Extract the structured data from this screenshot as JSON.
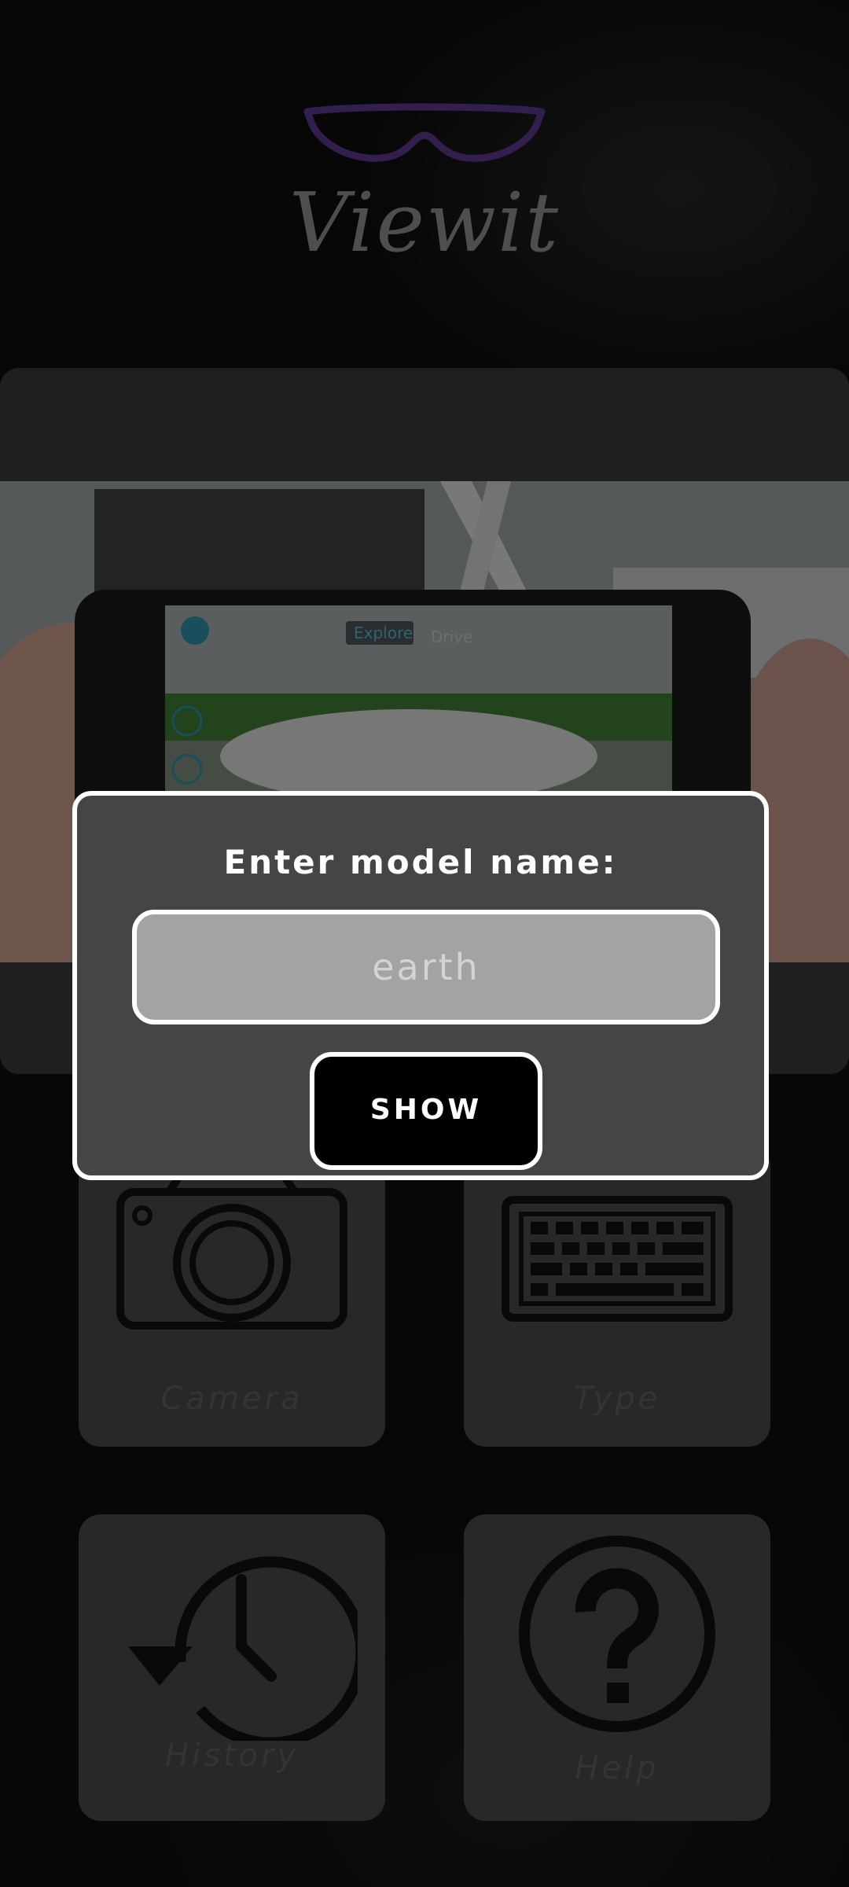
{
  "app": {
    "title": "Viewit"
  },
  "banner": {
    "ar_tabs": [
      "Explore",
      "Drive"
    ]
  },
  "menu": {
    "camera_label": "Camera",
    "type_label": "Type",
    "history_label": "History",
    "help_label": "Help"
  },
  "dialog": {
    "title": "Enter model name:",
    "input_placeholder": "earth",
    "input_value": "",
    "show_label": "SHOW"
  },
  "colors": {
    "logo_purple": "#5b3a8c",
    "dialog_bg": "#454545",
    "input_bg": "#a3a3a3"
  }
}
